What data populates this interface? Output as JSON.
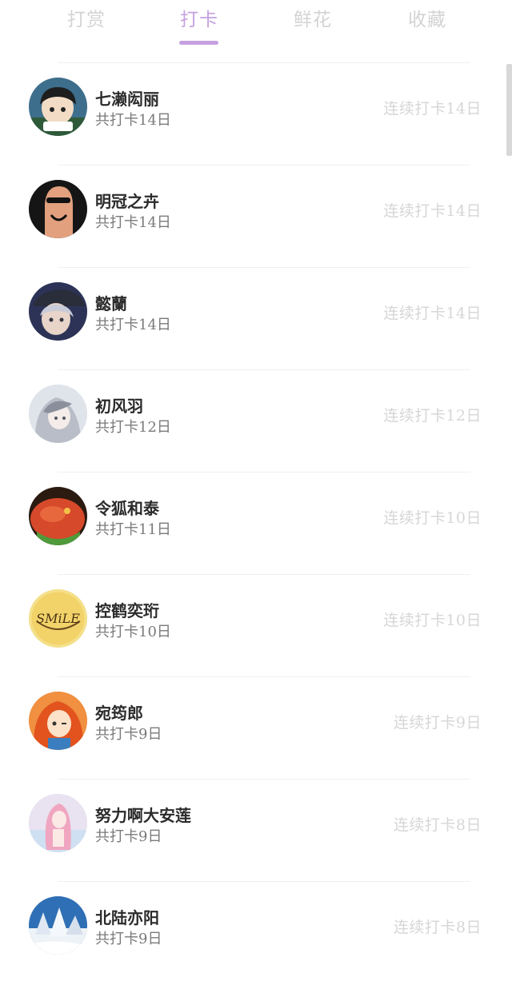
{
  "tabs": [
    {
      "label": "打赏",
      "active": false
    },
    {
      "label": "打卡",
      "active": true
    },
    {
      "label": "鲜花",
      "active": false
    },
    {
      "label": "收藏",
      "active": false
    }
  ],
  "accent_color": "#c6a0df",
  "items": [
    {
      "name": "七濑闳丽",
      "total": "共打卡14日",
      "streak": "连续打卡14日",
      "avatar": "cartoon-boy-avatar"
    },
    {
      "name": "明冠之卉",
      "total": "共打卡14日",
      "streak": "连续打卡14日",
      "avatar": "finger-face-avatar"
    },
    {
      "name": "懿蘭",
      "total": "共打卡14日",
      "streak": "连续打卡14日",
      "avatar": "anime-character-avatar"
    },
    {
      "name": "初风羽",
      "total": "共打卡12日",
      "streak": "连续打卡12日",
      "avatar": "anime-girl-avatar"
    },
    {
      "name": "令狐和泰",
      "total": "共打卡11日",
      "streak": "连续打卡10日",
      "avatar": "food-dish-avatar"
    },
    {
      "name": "控鹤奕珩",
      "total": "共打卡10日",
      "streak": "连续打卡10日",
      "avatar": "smile-logo-avatar"
    },
    {
      "name": "宛筠郎",
      "total": "共打卡9日",
      "streak": "连续打卡9日",
      "avatar": "cartoon-girl-avatar"
    },
    {
      "name": "努力啊大安莲",
      "total": "共打卡9日",
      "streak": "连续打卡8日",
      "avatar": "pink-hair-girl-avatar"
    },
    {
      "name": "北陆亦阳",
      "total": "共打卡9日",
      "streak": "连续打卡8日",
      "avatar": "snow-landscape-avatar"
    }
  ]
}
